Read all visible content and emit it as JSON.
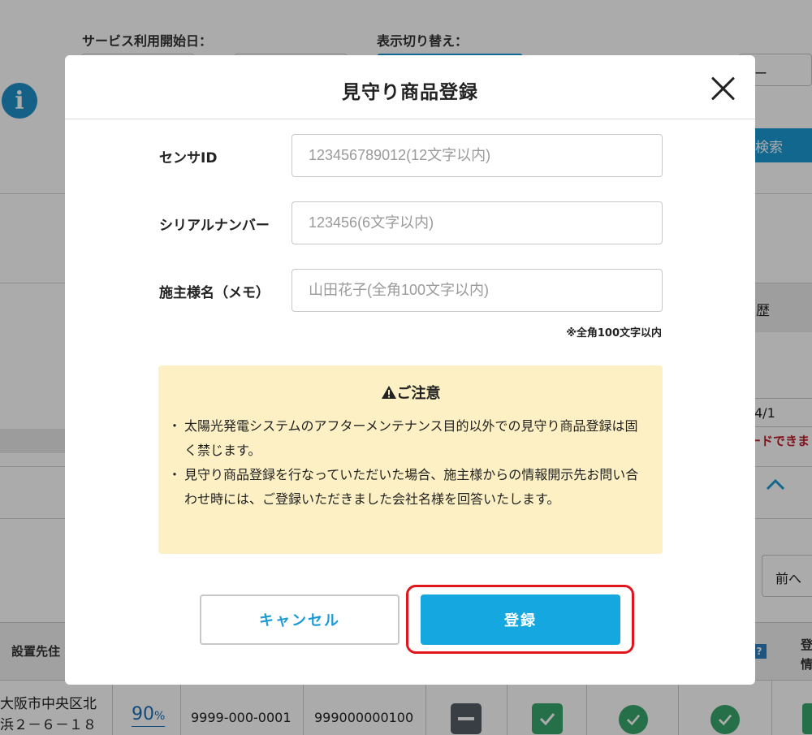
{
  "background": {
    "service_start_label": "サービス利用開始日：",
    "display_switch_label": "表示切り替え：",
    "dropdown_partial": "ー",
    "search_button": "検索",
    "tab_partial": "歴",
    "date_partial": "4/1",
    "red_notice_partial": "ードできま",
    "prev_button": "前へ",
    "table": {
      "headers": {
        "install_location": "設置先住",
        "help": "?",
        "last_col_line1": "登",
        "last_col_line2": "情"
      },
      "row": {
        "address": "大阪市中央区北\n浜２－６－１８",
        "percent_value": "90",
        "percent_unit": "%",
        "code": "9999-000-0001",
        "number": "999000000100"
      }
    }
  },
  "modal": {
    "title": "見守り商品登録",
    "close_icon": "close-icon",
    "fields": {
      "sensor_id": {
        "label": "センサID",
        "placeholder": "123456789012(12文字以内)"
      },
      "serial_number": {
        "label": "シリアルナンバー",
        "placeholder": "123456(6文字以内)"
      },
      "owner_name": {
        "label": "施主様名（メモ）",
        "placeholder": "山田花子(全角100文字以内)"
      }
    },
    "owner_name_hint": "※全角100文字以内",
    "notice": {
      "icon": "warning-icon",
      "title": "ご注意",
      "items": [
        "太陽光発電システムのアフターメンテナンス目的以外での見守り商品登録は固く禁じます。",
        "見守り商品登録を行なっていただいた場合、施主様からの情報開示先お問い合わせ時には、ご登録いただきました会社名様を回答いたします。"
      ]
    },
    "cancel_button": "キャンセル",
    "register_button": "登録"
  },
  "colors": {
    "primary": "#14a7e0",
    "highlight": "#e0161e",
    "notice_bg": "#fdf0c4",
    "link": "#1b6fb7",
    "check_green": "#3aa76d"
  }
}
